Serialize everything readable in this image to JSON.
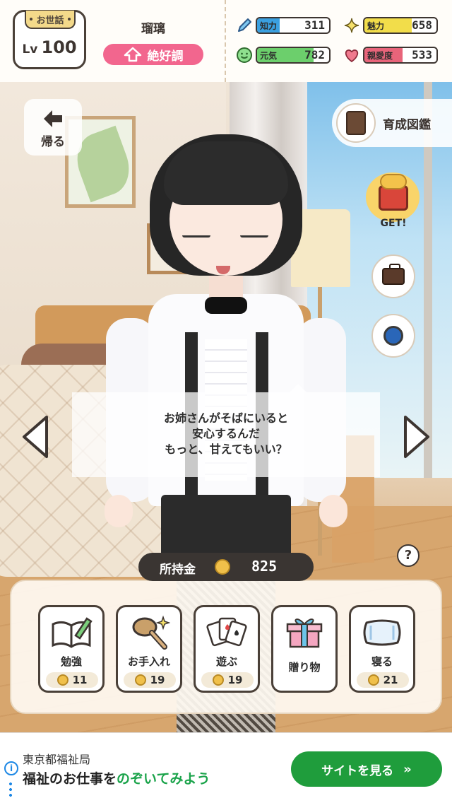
{
  "header": {
    "care_label": "お世話",
    "level_prefix": "Lv",
    "level": "100",
    "character_name": "瑠璃",
    "mood": "絶好調",
    "stats": [
      {
        "label": "知力",
        "value": "311",
        "icon": "pencil-icon",
        "color": "#3aa0e0",
        "fill": 0.31
      },
      {
        "label": "魅力",
        "value": "658",
        "icon": "sparkle-icon",
        "color": "#f2dd4a",
        "fill": 0.66
      },
      {
        "label": "元気",
        "value": "782",
        "icon": "smile-icon",
        "color": "#6ccf6c",
        "fill": 0.78
      },
      {
        "label": "親愛度",
        "value": "533",
        "icon": "heart-icon",
        "color": "#e8647a",
        "fill": 0.53
      }
    ]
  },
  "buttons": {
    "back": "帰る",
    "guide": "育成図鑑",
    "get": "GET!"
  },
  "speech": {
    "lines": [
      "お姉さんがそばにいると",
      "安心するんだ",
      "もっと、甘えてもいい？"
    ]
  },
  "help": "?",
  "money": {
    "label": "所持金",
    "amount": "825"
  },
  "actions": [
    {
      "name": "勉強",
      "cost": "11",
      "icon": "book-icon"
    },
    {
      "name": "お手入れ",
      "cost": "19",
      "icon": "brush-icon"
    },
    {
      "name": "遊ぶ",
      "cost": "19",
      "icon": "cards-icon"
    },
    {
      "name": "贈り物",
      "cost": "",
      "icon": "gift-icon"
    },
    {
      "name": "寝る",
      "cost": "21",
      "icon": "pillow-icon"
    }
  ],
  "ad": {
    "org": "東京都福祉局",
    "headline_a": "福祉のお仕事を",
    "headline_b": "のぞいてみよう",
    "cta": "サイトを見る",
    "cta_chevron": "»"
  },
  "colors": {
    "mood_bg": "#f2668e",
    "money_bg": "#3a3532",
    "cta_bg": "#1f9d3c"
  }
}
